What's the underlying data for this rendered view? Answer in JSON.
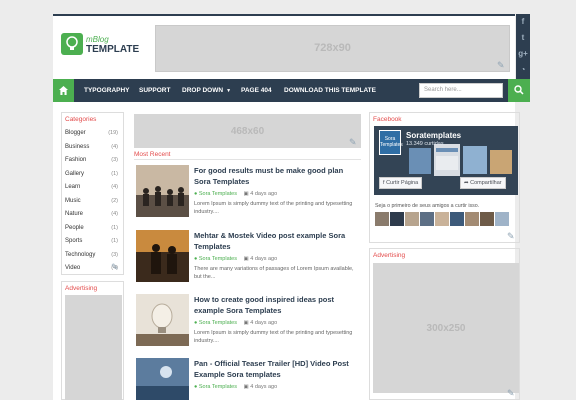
{
  "header": {
    "logo_small": "mBlog",
    "logo_big": "TEMPLATE",
    "ad_728_label": "728x90"
  },
  "social_icons": [
    "facebook-icon",
    "twitter-icon",
    "google-plus-icon",
    "rss-icon"
  ],
  "nav": {
    "items": [
      {
        "label": "TYPOGRAPHY"
      },
      {
        "label": "SUPPORT"
      },
      {
        "label": "DROP DOWN"
      },
      {
        "label": "PAGE 404"
      },
      {
        "label": "DOWNLOAD THIS TEMPLATE"
      }
    ],
    "search_placeholder": "Search here..."
  },
  "categories": {
    "title": "Categories",
    "items": [
      {
        "name": "Blogger",
        "count": "(19)"
      },
      {
        "name": "Business",
        "count": "(4)"
      },
      {
        "name": "Fashion",
        "count": "(3)"
      },
      {
        "name": "Gallery",
        "count": "(1)"
      },
      {
        "name": "Learn",
        "count": "(4)"
      },
      {
        "name": "Music",
        "count": "(2)"
      },
      {
        "name": "Nature",
        "count": "(4)"
      },
      {
        "name": "People",
        "count": "(1)"
      },
      {
        "name": "Sports",
        "count": "(1)"
      },
      {
        "name": "Technology",
        "count": "(3)"
      },
      {
        "name": "Video",
        "count": "(4)"
      }
    ]
  },
  "left_ad": {
    "title": "Advertising"
  },
  "main": {
    "ad_468_label": "468x60",
    "section_title": "Most Recent",
    "posts": [
      {
        "title": "For good results must be make good plan Sora Templates",
        "author": "Sora Templates",
        "date": "4 days ago",
        "excerpt": "Lorem Ipsum is simply dummy text of the printing and typesetting industry...."
      },
      {
        "title": "Mehtar & Mostek Video post example Sora Templates",
        "author": "Sora Templates",
        "date": "4 days ago",
        "excerpt": "There are many variations of passages of Lorem Ipsum available, but the..."
      },
      {
        "title": "How to create good inspired ideas post example Sora Templates",
        "author": "Sora Templates",
        "date": "4 days ago",
        "excerpt": "Lorem Ipsum is simply dummy text of the printing and typesetting industry...."
      },
      {
        "title": "Pan - Official Teaser Trailer [HD] Video Post Example Sora templates",
        "author": "Sora Templates",
        "date": "4 days ago",
        "excerpt": ""
      }
    ]
  },
  "facebook": {
    "title": "Facebook",
    "page_name": "Soratemplates",
    "likes": "13.349 curtidas",
    "avatar_text": "Sora Templates",
    "like_button": "Curtir Página",
    "share_button": "Compartilhar",
    "note": "Seja o primeiro de seus amigos a curtir isso."
  },
  "right_ad": {
    "title": "Advertising",
    "ad_300_label": "300x250"
  },
  "colors": {
    "accent": "#4caf50",
    "nav_bg": "#2d3e50",
    "widget_title": "#e34b4b"
  }
}
